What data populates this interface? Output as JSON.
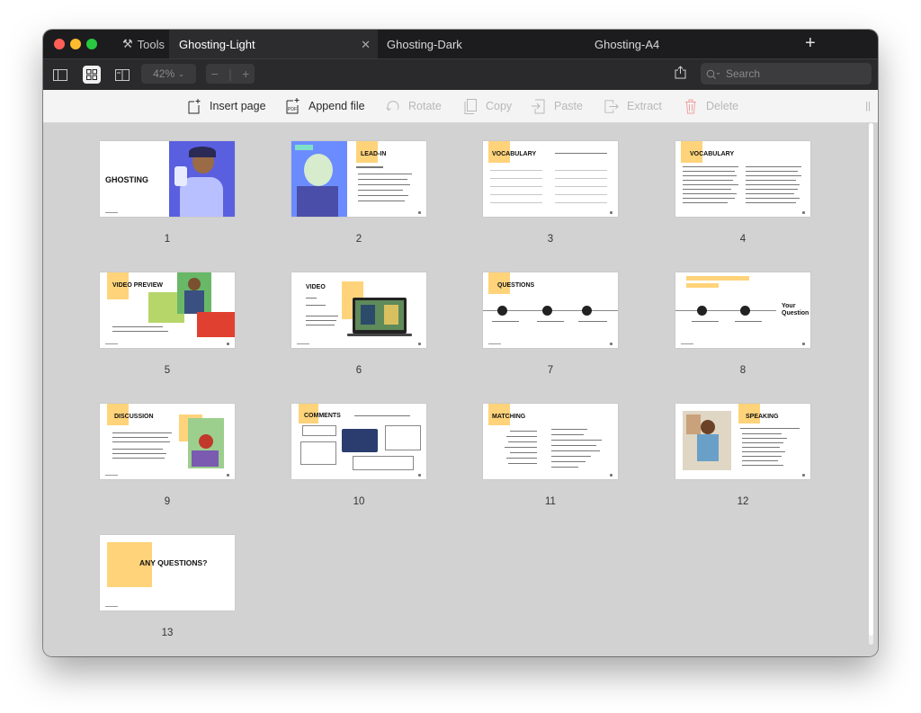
{
  "window": {
    "tools_label": "Tools",
    "tabs": [
      {
        "label": "Ghosting-Light",
        "active": true
      },
      {
        "label": "Ghosting-Dark",
        "active": false
      },
      {
        "label": "Ghosting-A4",
        "active": false
      }
    ],
    "new_tab": "+",
    "close_tab": "✕"
  },
  "toolbar": {
    "zoom": "42%",
    "zoom_minus": "−",
    "zoom_plus": "+",
    "search_placeholder": "Search"
  },
  "actions": {
    "insert_page": "Insert page",
    "append_file": "Append file",
    "rotate": "Rotate",
    "copy": "Copy",
    "paste": "Paste",
    "extract": "Extract",
    "delete": "Delete"
  },
  "pages": [
    {
      "number": "1",
      "title": "GHOSTING"
    },
    {
      "number": "2",
      "title": "LEAD-IN"
    },
    {
      "number": "3",
      "title": "VOCABULARY"
    },
    {
      "number": "4",
      "title": "VOCABULARY"
    },
    {
      "number": "5",
      "title": "VIDEO PREVIEW"
    },
    {
      "number": "6",
      "title": "VIDEO"
    },
    {
      "number": "7",
      "title": "QUESTIONS"
    },
    {
      "number": "8",
      "title": "Your Question"
    },
    {
      "number": "9",
      "title": "DISCUSSION"
    },
    {
      "number": "10",
      "title": "COMMENTS"
    },
    {
      "number": "11",
      "title": "MATCHING"
    },
    {
      "number": "12",
      "title": "SPEAKING"
    },
    {
      "number": "13",
      "title": "ANY QUESTIONS?"
    }
  ],
  "colors": {
    "accent_yellow": "#ffd37a",
    "titlebar": "#1c1c1e",
    "canvas": "#d2d2d2",
    "delete_red": "#f0a0a0"
  }
}
